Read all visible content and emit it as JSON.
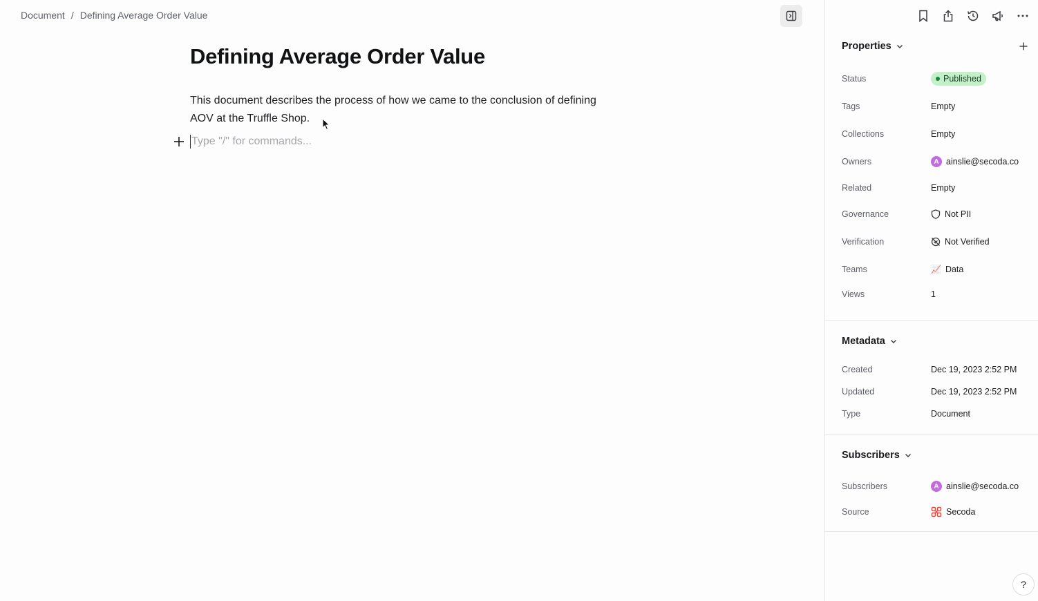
{
  "breadcrumb": {
    "root": "Document",
    "separator": "/",
    "current": "Defining Average Order Value"
  },
  "document": {
    "title": "Defining Average Order Value",
    "body": "This document describes the process of how we came to the conclusion of defining AOV at the Truffle Shop.",
    "placeholder": "Type \"/\" for commands..."
  },
  "sidebar": {
    "icons": [
      "bookmark-icon",
      "share-icon",
      "history-icon",
      "announce-icon",
      "more-icon"
    ],
    "properties": {
      "title": "Properties",
      "status": {
        "label": "Status",
        "value": "Published"
      },
      "tags": {
        "label": "Tags",
        "value": "Empty"
      },
      "collections": {
        "label": "Collections",
        "value": "Empty"
      },
      "owners": {
        "label": "Owners",
        "value": "ainslie@secoda.co",
        "avatar": "A"
      },
      "related": {
        "label": "Related",
        "value": "Empty"
      },
      "governance": {
        "label": "Governance",
        "value": "Not PII"
      },
      "verification": {
        "label": "Verification",
        "value": "Not Verified"
      },
      "teams": {
        "label": "Teams",
        "value": "Data",
        "emoji": "📈"
      },
      "views": {
        "label": "Views",
        "value": "1"
      }
    },
    "metadata": {
      "title": "Metadata",
      "created": {
        "label": "Created",
        "value": "Dec 19, 2023 2:52 PM"
      },
      "updated": {
        "label": "Updated",
        "value": "Dec 19, 2023 2:52 PM"
      },
      "type": {
        "label": "Type",
        "value": "Document"
      }
    },
    "subscribers": {
      "title": "Subscribers",
      "subscribers": {
        "label": "Subscribers",
        "value": "ainslie@secoda.co",
        "avatar": "A"
      },
      "source": {
        "label": "Source",
        "value": "Secoda"
      }
    },
    "help": "?"
  },
  "colors": {
    "published_badge": "#c3f0c8",
    "avatar": "#c26be0",
    "secoda": "#e8453c"
  }
}
